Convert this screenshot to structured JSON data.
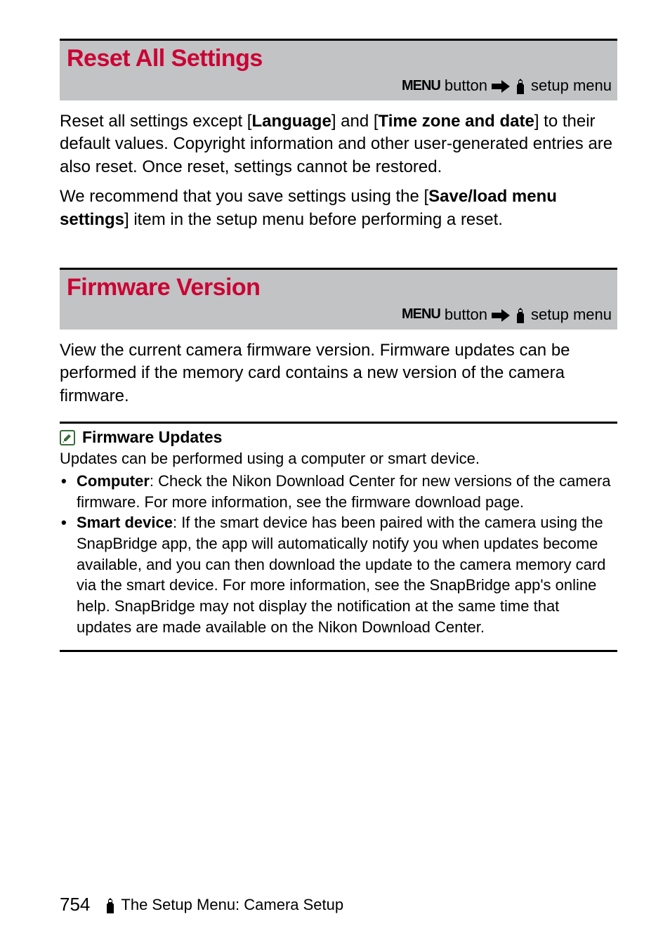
{
  "section1": {
    "title": "Reset All Settings",
    "breadcrumb_prefix": "MENU",
    "breadcrumb_button": "button",
    "breadcrumb_suffix": "setup menu",
    "para1_a": "Reset all settings except [",
    "para1_b": "Language",
    "para1_c": "] and [",
    "para1_d": "Time zone and date",
    "para1_e": "] to their default values. Copyright information and other user-generated entries are also reset. Once reset, settings cannot be restored.",
    "para2_a": "We recommend that you save settings using the [",
    "para2_b": "Save/load menu settings",
    "para2_c": "] item in the setup menu before performing a reset."
  },
  "section2": {
    "title": "Firmware Version",
    "breadcrumb_prefix": "MENU",
    "breadcrumb_button": "button",
    "breadcrumb_suffix": "setup menu",
    "para1": "View the current camera firmware version. Firmware updates can be performed if the memory card contains a new version of the camera firmware."
  },
  "tip": {
    "title": "Firmware Updates",
    "intro": "Updates can be performed using a computer or smart device.",
    "item1_label": "Computer",
    "item1_text": ": Check the Nikon Download Center for new versions of the camera firmware. For more information, see the firmware download page.",
    "item2_label": "Smart device",
    "item2_text": ": If the smart device has been paired with the camera using the SnapBridge app, the app will automatically notify you when updates become available, and you can then download the update to the camera memory card via the smart device. For more information, see the SnapBridge app's online help. SnapBridge may not display the notification at the same time that updates are made available on the Nikon Download Center."
  },
  "footer": {
    "page": "754",
    "label": "The Setup Menu: Camera Setup"
  }
}
